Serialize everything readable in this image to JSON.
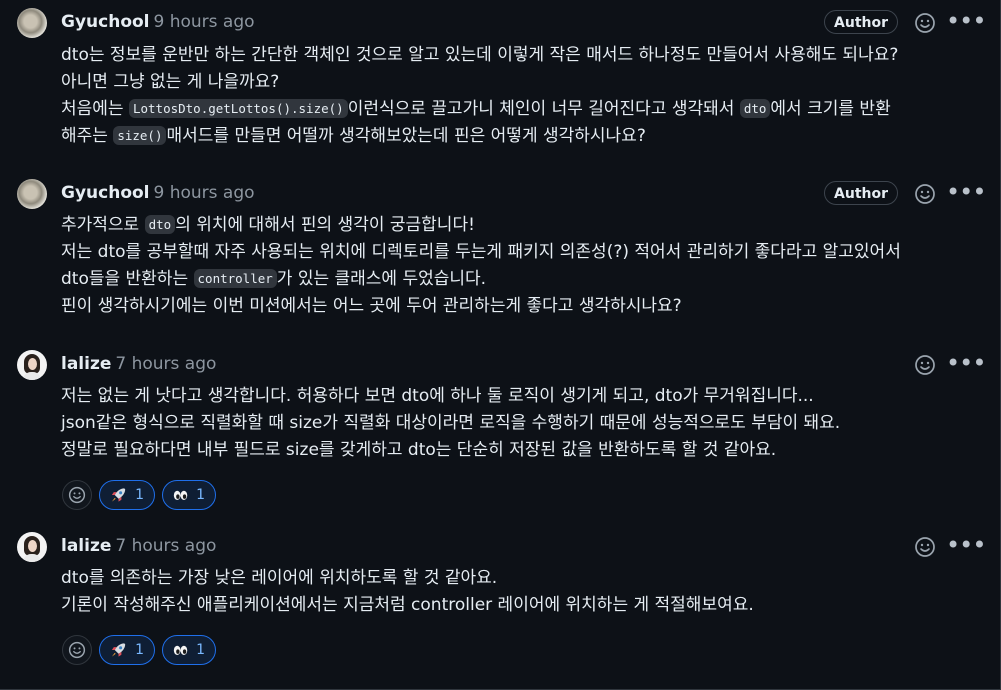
{
  "comments": [
    {
      "author": "Gyuchool",
      "time": "9 hours ago",
      "badge": "Author",
      "lines": [
        [
          {
            "t": "dto는 정보를 운반만 하는 간단한 객체인 것으로 알고 있는데 이렇게 작은 매서드 하나정도 만들어서 사용해도 되나요?"
          }
        ],
        [
          {
            "t": "아니면 그냥 없는 게 나을까요?"
          }
        ],
        [
          {
            "t": "처음에는 "
          },
          {
            "code": "LottosDto.getLottos().size()"
          },
          {
            "t": "이런식으로 끌고가니 체인이 너무 길어진다고 생각돼서 "
          },
          {
            "code": "dto"
          },
          {
            "t": "에서 크기를 반환"
          }
        ],
        [
          {
            "t": "해주는 "
          },
          {
            "code": "size()"
          },
          {
            "t": "매서드를 만들면 어떨까 생각해보았는데 핀은 어떻게 생각하시나요?"
          }
        ]
      ]
    },
    {
      "author": "Gyuchool",
      "time": "9 hours ago",
      "badge": "Author",
      "lines": [
        [
          {
            "t": "추가적으로 "
          },
          {
            "code": "dto"
          },
          {
            "t": "의 위치에 대해서 핀의 생각이 궁금합니다!"
          }
        ],
        [
          {
            "t": "저는 dto를 공부할때 자주 사용되는 위치에 디렉토리를 두는게 패키지 의존성(?) 적어서 관리하기 좋다라고 알고있어서"
          }
        ],
        [
          {
            "t": "dto들을 반환하는 "
          },
          {
            "code": "controller"
          },
          {
            "t": "가 있는 클래스에 두었습니다."
          }
        ],
        [
          {
            "t": "핀이 생각하시기에는 이번 미션에서는 어느 곳에 두어 관리하는게 좋다고 생각하시나요?"
          }
        ]
      ]
    },
    {
      "author": "lalize",
      "time": "7 hours ago",
      "badge": "",
      "lines": [
        [
          {
            "t": "저는 없는 게 낫다고 생각합니다. 허용하다 보면 dto에 하나 둘 로직이 생기게 되고, dto가 무거워집니다..."
          }
        ],
        [
          {
            "t": "json같은 형식으로 직렬화할 때 size가 직렬화 대상이라면 로직을 수행하기 때문에 성능적으로도 부담이 돼요."
          }
        ],
        [
          {
            "t": "정말로 필요하다면 내부 필드로 size를 갖게하고 dto는 단순히 저장된 값을 반환하도록 할 것 같아요."
          }
        ]
      ],
      "reactions": {
        "rocket": "1",
        "eyes": "1"
      }
    },
    {
      "author": "lalize",
      "time": "7 hours ago",
      "badge": "",
      "lines": [
        [
          {
            "t": "dto를 의존하는 가장 낮은 레이어에 위치하도록 할 것 같아요."
          }
        ],
        [
          {
            "t": "기론이 작성해주신 애플리케이션에서는 지금처럼 controller 레이어에 위치하는 게 적절해보여요."
          }
        ]
      ],
      "reactions": {
        "rocket": "1",
        "eyes": "1"
      }
    }
  ],
  "icons": {
    "smiley": "smiley-icon",
    "kebab": "kebab-horizontal-icon",
    "rocket": "rocket-icon",
    "eyes": "eyes-icon"
  },
  "colors": {
    "background": "#0d1117",
    "text": "#e6edf3",
    "muted": "#8d96a0",
    "border": "#30363d",
    "reaction_accent": "#1f6feb"
  }
}
